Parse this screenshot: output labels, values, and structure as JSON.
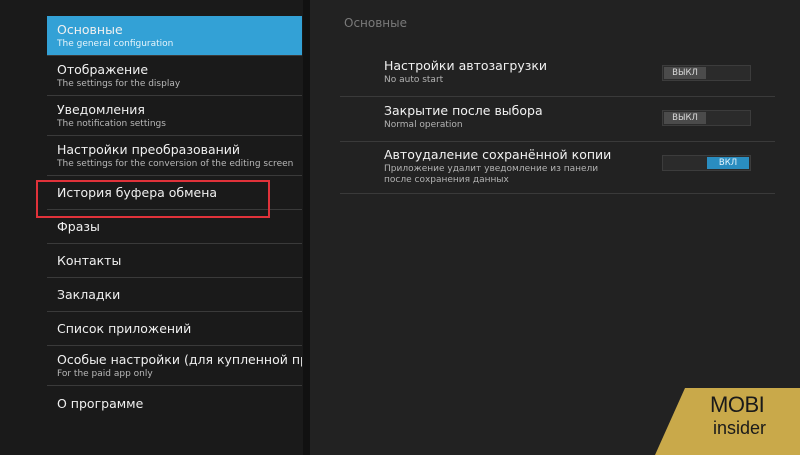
{
  "sidebar": {
    "items": [
      {
        "title": "Основные",
        "sub": "The general configuration",
        "active": true
      },
      {
        "title": "Отображение",
        "sub": "The settings for the display"
      },
      {
        "title": "Уведомления",
        "sub": "The notification settings"
      },
      {
        "title": "Настройки преобразований",
        "sub": "The settings for the conversion of the editing screen"
      },
      {
        "title": "История буфера обмена"
      },
      {
        "title": "Фразы"
      },
      {
        "title": "Контакты"
      },
      {
        "title": "Закладки"
      },
      {
        "title": "Список приложений"
      },
      {
        "title": "Особые настройки (для купленной прог",
        "sub": "For the paid app only"
      },
      {
        "title": "О программе"
      }
    ]
  },
  "content": {
    "header": "Основные",
    "settings": [
      {
        "title": "Настройки автозагрузки",
        "sub": "No auto start",
        "toggle": "ВЫКЛ",
        "state": "off"
      },
      {
        "title": "Закрытие после выбора",
        "sub": "Normal operation",
        "toggle": "ВЫКЛ",
        "state": "off"
      },
      {
        "title": "Автоудаление сохранённой копии",
        "sub": "Приложение удалит уведомление из панели после сохранения данных",
        "toggle": "ВКЛ",
        "state": "on"
      }
    ]
  },
  "watermark": {
    "line1": "MOBI",
    "line2": "insider"
  },
  "colors": {
    "accent": "#33a1d6",
    "highlight": "#e0323a",
    "logo_bg": "#c9a94a"
  }
}
